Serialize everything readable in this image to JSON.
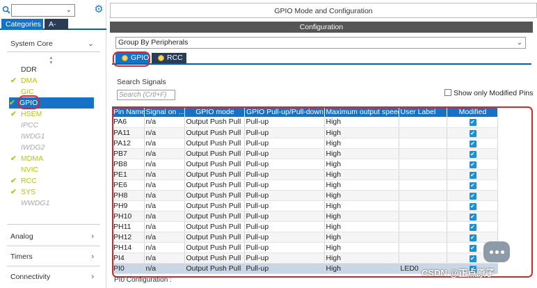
{
  "left": {
    "tabs": [
      "Categories",
      "A->Z"
    ],
    "categories": {
      "system_core": "System Core",
      "analog": "Analog",
      "timers": "Timers",
      "connectivity": "Connectivity"
    },
    "peripherals": [
      {
        "label": "DDR",
        "state": "normal",
        "check": ""
      },
      {
        "label": "DMA",
        "state": "ok",
        "check": "✔"
      },
      {
        "label": "GIC",
        "state": "warn",
        "check": ""
      },
      {
        "label": "GPIO",
        "state": "selected",
        "check": "✔"
      },
      {
        "label": "HSEM",
        "state": "ok",
        "check": "✔"
      },
      {
        "label": "IPCC",
        "state": "disabled",
        "check": ""
      },
      {
        "label": "IWDG1",
        "state": "disabled",
        "check": ""
      },
      {
        "label": "IWDG2",
        "state": "disabled",
        "check": ""
      },
      {
        "label": "MDMA",
        "state": "ok",
        "check": "✔"
      },
      {
        "label": "NVIC",
        "state": "warn",
        "check": ""
      },
      {
        "label": "RCC",
        "state": "ok",
        "check": "✔"
      },
      {
        "label": "SYS",
        "state": "ok",
        "check": "✔"
      },
      {
        "label": "WWDG1",
        "state": "disabled",
        "check": ""
      }
    ]
  },
  "right": {
    "title": "GPIO Mode and Configuration",
    "config_header": "Configuration",
    "group_by": "Group By Peripherals",
    "peripheral_tabs": [
      "GPIO",
      "RCC"
    ],
    "search_label": "Search Signals",
    "search_placeholder": "Search (Crtl+F)",
    "show_modified": "Show only Modified Pins",
    "pin_config_label": "PI0 Configuration :"
  },
  "table": {
    "headers": [
      "Pin Name",
      "Signal on ...",
      "GPIO mode",
      "GPIO Pull-up/Pull-down",
      "Maximum output speed",
      "User Label",
      "Modified"
    ],
    "rows": [
      {
        "pin": "PA6",
        "signal": "n/a",
        "mode": "Output Push Pull",
        "pull": "Pull-up",
        "speed": "High",
        "label": "",
        "modified": true
      },
      {
        "pin": "PA11",
        "signal": "n/a",
        "mode": "Output Push Pull",
        "pull": "Pull-up",
        "speed": "High",
        "label": "",
        "modified": true
      },
      {
        "pin": "PA12",
        "signal": "n/a",
        "mode": "Output Push Pull",
        "pull": "Pull-up",
        "speed": "High",
        "label": "",
        "modified": true
      },
      {
        "pin": "PB7",
        "signal": "n/a",
        "mode": "Output Push Pull",
        "pull": "Pull-up",
        "speed": "High",
        "label": "",
        "modified": true
      },
      {
        "pin": "PB8",
        "signal": "n/a",
        "mode": "Output Push Pull",
        "pull": "Pull-up",
        "speed": "High",
        "label": "",
        "modified": true
      },
      {
        "pin": "PE1",
        "signal": "n/a",
        "mode": "Output Push Pull",
        "pull": "Pull-up",
        "speed": "High",
        "label": "",
        "modified": true
      },
      {
        "pin": "PE6",
        "signal": "n/a",
        "mode": "Output Push Pull",
        "pull": "Pull-up",
        "speed": "High",
        "label": "",
        "modified": true
      },
      {
        "pin": "PH8",
        "signal": "n/a",
        "mode": "Output Push Pull",
        "pull": "Pull-up",
        "speed": "High",
        "label": "",
        "modified": true
      },
      {
        "pin": "PH9",
        "signal": "n/a",
        "mode": "Output Push Pull",
        "pull": "Pull-up",
        "speed": "High",
        "label": "",
        "modified": true
      },
      {
        "pin": "PH10",
        "signal": "n/a",
        "mode": "Output Push Pull",
        "pull": "Pull-up",
        "speed": "High",
        "label": "",
        "modified": true
      },
      {
        "pin": "PH11",
        "signal": "n/a",
        "mode": "Output Push Pull",
        "pull": "Pull-up",
        "speed": "High",
        "label": "",
        "modified": true
      },
      {
        "pin": "PH12",
        "signal": "n/a",
        "mode": "Output Push Pull",
        "pull": "Pull-up",
        "speed": "High",
        "label": "",
        "modified": true
      },
      {
        "pin": "PH14",
        "signal": "n/a",
        "mode": "Output Push Pull",
        "pull": "Pull-up",
        "speed": "High",
        "label": "",
        "modified": true
      },
      {
        "pin": "PI4",
        "signal": "n/a",
        "mode": "Output Push Pull",
        "pull": "Pull-up",
        "speed": "High",
        "label": "",
        "modified": true
      },
      {
        "pin": "PI0",
        "signal": "n/a",
        "mode": "Output Push Pull",
        "pull": "Pull-up",
        "speed": "High",
        "label": "LED0",
        "modified": true,
        "selected": true
      }
    ]
  },
  "watermark": "CSDN @正点原子",
  "colors": {
    "accent": "#1672c6",
    "dark_tab": "#2b3c57",
    "ok_green": "#b6c51b",
    "highlight_red": "#e0232a"
  },
  "icons": [
    "search-icon",
    "chevron-down-icon",
    "gear-icon",
    "sort-arrows-icon",
    "check-icon",
    "chevron-right-icon",
    "chat-icon"
  ]
}
